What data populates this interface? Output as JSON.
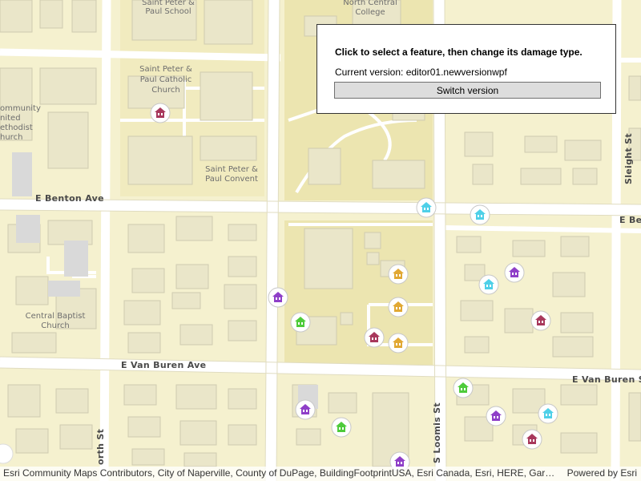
{
  "panel": {
    "instruction": "Click to select a feature, then change its damage type.",
    "version_prefix": "Current version: ",
    "version_name": "editor01.newversionwpf",
    "switch_label": "Switch version"
  },
  "attribution": {
    "sources": "Esri Community Maps Contributors, City of Naperville, County of DuPage, BuildingFootprintUSA, Esri Canada, Esri, HERE, Garmin, S...",
    "powered_by": "Powered by Esri"
  },
  "map_labels": {
    "st_peter_paul_school_1": "Saint Peter &",
    "st_peter_paul_school_2": "Paul School",
    "north_central_1": "North Central",
    "north_central_2": "College",
    "catholic_church_1": "Saint Peter &",
    "catholic_church_2": "Paul Catholic",
    "catholic_church_3": "Church",
    "convent_1": "Saint Peter &",
    "convent_2": "Paul Convent",
    "methodist_1": "ommunity",
    "methodist_2": "nited",
    "methodist_3": "ethodist",
    "methodist_4": "hurch",
    "central_baptist_1": "Central Baptist",
    "central_baptist_2": "Church",
    "e_benton": "E Benton Ave",
    "e_benton_right": "E Be",
    "e_van_buren": "E Van Buren Ave",
    "e_van_buren_right": "E Van Buren St",
    "s_loomis": "S Loomis St",
    "sleight": "Sleight St",
    "north_st": "orth St"
  },
  "damage_colors": {
    "destroyed": "#a8385c",
    "major": "#8f3fc8",
    "minor": "#e1a833",
    "affected": "#4ecb3b",
    "inaccessible": "#4fd0e8"
  },
  "features": [
    {
      "type": "destroyed"
    },
    {
      "type": "inaccessible"
    },
    {
      "type": "inaccessible"
    },
    {
      "type": "major"
    },
    {
      "type": "minor"
    },
    {
      "type": "inaccessible"
    },
    {
      "type": "major"
    },
    {
      "type": "minor"
    },
    {
      "type": "affected"
    },
    {
      "type": "destroyed"
    },
    {
      "type": "minor"
    },
    {
      "type": "destroyed"
    },
    {
      "type": "affected"
    },
    {
      "type": "major"
    },
    {
      "type": "affected"
    },
    {
      "type": "major"
    },
    {
      "type": "inaccessible"
    },
    {
      "type": "destroyed"
    },
    {
      "type": "major"
    }
  ]
}
